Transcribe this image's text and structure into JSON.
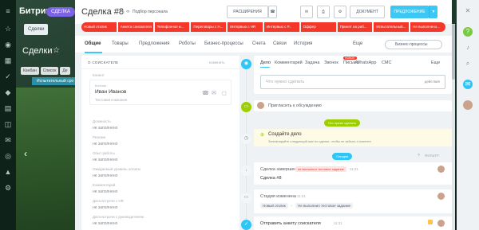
{
  "portal": {
    "title": "Битрикс",
    "deal_badge": "СДЕЛКА",
    "tab": "Сделки",
    "heading": "Сделки",
    "chips": [
      "Канбан",
      "Список",
      "Де"
    ],
    "strip": "Испытательный сро"
  },
  "header": {
    "deal_title": "Сделка #8",
    "persona": "Подбор персонала",
    "extensions": "РАСШИРЕНИЯ",
    "document": "ДОКУМЕНТ",
    "offer": "ПРЕДЛОЖЕНИЕ"
  },
  "stages": [
    "Новый отклик",
    "Анкета соискателя",
    "Телефонное и...",
    "Переговоры с Н...",
    "Интервью с HR",
    "Интервью с Р...",
    "Оффер",
    "Принят на раб...",
    "Испытательный...",
    "Не выполнено..."
  ],
  "tabs": {
    "items": [
      "Общие",
      "Товары",
      "Предложения",
      "Роботы",
      "Бизнес-процессы",
      "Счета",
      "Связи",
      "История",
      "Еще"
    ],
    "bp_button": "Бизнес-процессы"
  },
  "about": {
    "heading": "О СОИСКАТЕЛЕ",
    "edit": "изменить",
    "client_label": "Клиент",
    "contact_label": "Контакт",
    "contact_name": "Иван Иванов",
    "contact_company": "Тестовая компания",
    "fields": [
      {
        "label": "Должность",
        "value": "не заполнено"
      },
      {
        "label": "Резюме",
        "value": "не заполнено"
      },
      {
        "label": "Опыт работы",
        "value": "не заполнено"
      },
      {
        "label": "Ожидаемый уровень оплаты",
        "value": "не заполнено"
      },
      {
        "label": "Комментарий",
        "value": "не заполнено"
      },
      {
        "label": "Дата встречи с HR",
        "value": "не заполнено"
      },
      {
        "label": "Дата встречи с руководителем",
        "value": "не заполнено"
      }
    ]
  },
  "editor": {
    "tabs": [
      "Дело",
      "Комментарий",
      "Задача",
      "Звонок",
      "Письмо",
      "WhatsApp",
      "СМС",
      "Еще"
    ],
    "new_badge": "НОВОЕ",
    "placeholder": "Что нужно сделать",
    "actions": "действия"
  },
  "timeline": {
    "invite": "Пригласить к обсуждению",
    "todo_pill": "Что нужно сделать",
    "create_title": "Создайте дело",
    "create_desc": "Запланируйте следующий шаг по сделке, чтобы не забыть о клиенте",
    "today_pill": "Сегодня",
    "filter": "ФИЛЬТР",
    "deal_done": "Сделка завершена",
    "fail_tag": "не выполнил тестовое задание",
    "deal_done_time": "11:21",
    "deal_ref": "Сделка #8",
    "stage_changed": "Стадия изменена",
    "stage_time": "11:21",
    "stage_from": "Новый отклик",
    "stage_to": "Не выполнил тестовое задание",
    "send_form": "Отправить анкету соискателя",
    "send_time": "11:21"
  }
}
